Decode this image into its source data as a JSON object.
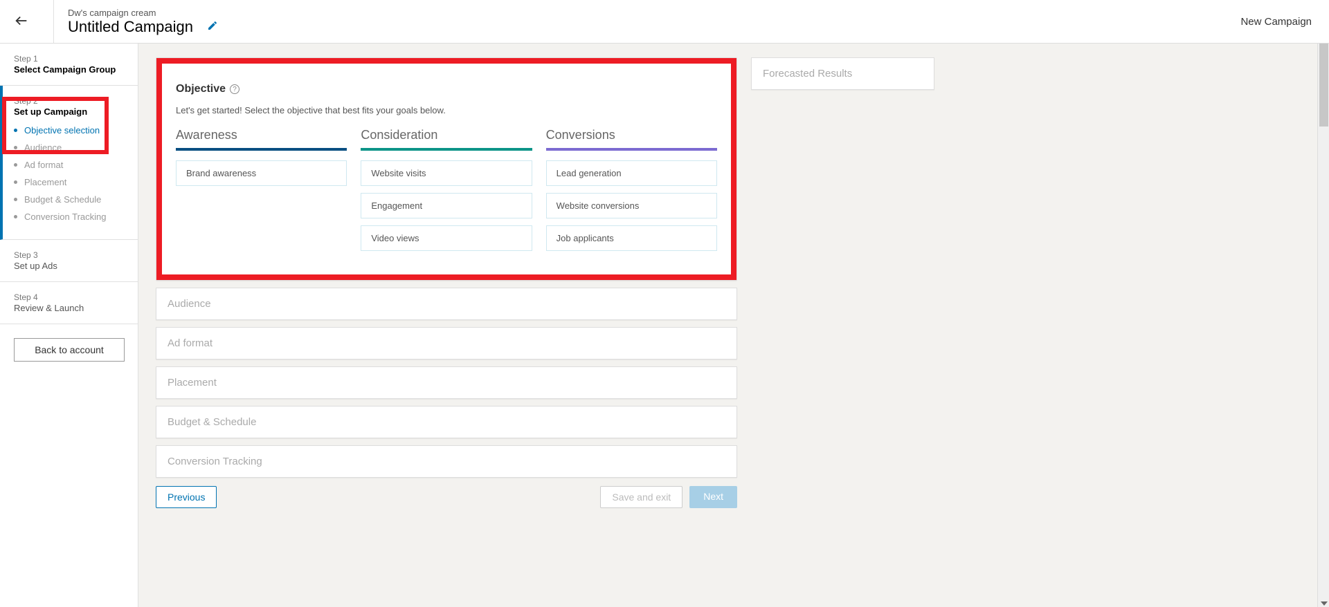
{
  "header": {
    "breadcrumb": "Dw's campaign cream",
    "title": "Untitled Campaign",
    "right_label": "New Campaign"
  },
  "sidebar": {
    "step1": {
      "num": "Step 1",
      "title": "Select Campaign Group"
    },
    "step2": {
      "num": "Step 2",
      "title": "Set up Campaign",
      "items": [
        {
          "label": "Objective selection",
          "active": true
        },
        {
          "label": "Audience"
        },
        {
          "label": "Ad format"
        },
        {
          "label": "Placement"
        },
        {
          "label": "Budget & Schedule"
        },
        {
          "label": "Conversion Tracking"
        }
      ]
    },
    "step3": {
      "num": "Step 3",
      "title": "Set up Ads"
    },
    "step4": {
      "num": "Step 4",
      "title": "Review & Launch"
    },
    "back_button": "Back to account"
  },
  "objective": {
    "title": "Objective",
    "subtitle": "Let's get started! Select the objective that best fits your goals below.",
    "columns": [
      {
        "name": "Awareness",
        "options": [
          "Brand awareness"
        ]
      },
      {
        "name": "Consideration",
        "options": [
          "Website visits",
          "Engagement",
          "Video views"
        ]
      },
      {
        "name": "Conversions",
        "options": [
          "Lead generation",
          "Website conversions",
          "Job applicants"
        ]
      }
    ]
  },
  "collapsed_sections": [
    "Audience",
    "Ad format",
    "Placement",
    "Budget & Schedule",
    "Conversion Tracking"
  ],
  "right_panel": {
    "title": "Forecasted Results"
  },
  "footer": {
    "previous": "Previous",
    "save_exit": "Save and exit",
    "next": "Next"
  }
}
